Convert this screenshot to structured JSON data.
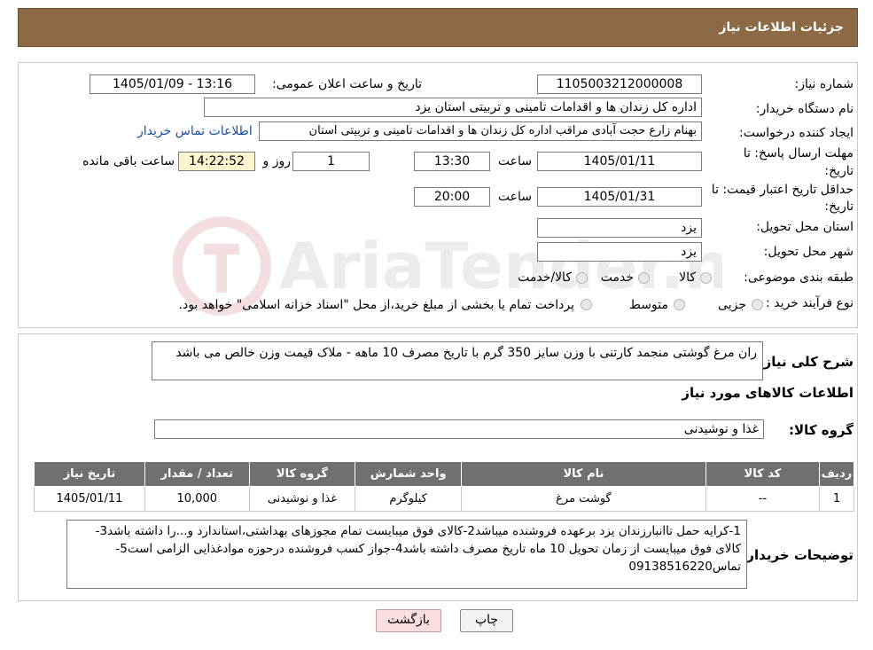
{
  "header": {
    "title": "جزئیات اطلاعات نیاز"
  },
  "form": {
    "need_number_label": "شماره نیاز:",
    "need_number": "1105003212000008",
    "announce_label": "تاریخ و ساعت اعلان عمومی:",
    "announce_value": "1405/01/09 - 13:16",
    "buyer_label": "نام دستگاه خریدار:",
    "buyer_value": "اداره کل زندان ها و اقدامات تامینی و تربیتی استان یزد",
    "creator_label": "ایجاد کننده درخواست:",
    "creator_value": "بهنام زارع حجت آبادی مراقب اداره کل زندان ها و اقدامات تامینی و تربیتی استان",
    "contact_link": "اطلاعات تماس خریدار",
    "deadline_label_1": "مهلت ارسال پاسخ: تا",
    "deadline_label_2": "تاریخ:",
    "deadline_date": "1405/01/11",
    "time_label": "ساعت",
    "deadline_time": "13:30",
    "days_value": "1",
    "days_label": "روز و",
    "remaining_value": "14:22:52",
    "remaining_label": "ساعت باقی مانده",
    "validity_label_1": "حداقل تاریخ اعتبار قیمت: تا",
    "validity_label_2": "تاریخ:",
    "validity_date": "1405/01/31",
    "validity_time": "20:00",
    "province_label": "استان محل تحویل:",
    "province_value": "یزد",
    "city_label": "شهر محل تحویل:",
    "city_value": "یزد",
    "category_label": "طبقه بندی موضوعی:",
    "category_opt_1": "کالا",
    "category_opt_2": "خدمت",
    "category_opt_3": "کالا/خدمت",
    "process_label": "نوع فرآیند خرید :",
    "process_opt_1": "جزیی",
    "process_opt_2": "متوسط",
    "process_note": "پرداخت تمام یا بخشی از مبلغ خرید،از محل \"اسناد خزانه اسلامی\" خواهد بود."
  },
  "description": {
    "label": "شرح کلی نیاز:",
    "value": "ران مرغ گوشتی منجمد کارتنی با وزن سایز 350 گرم با تاریخ مصرف 10 ماهه - ملاک قیمت وزن خالص می باشد"
  },
  "goods": {
    "section_title": "اطلاعات کالاهای مورد نیاز",
    "group_label": "گروه کالا:",
    "group_value": "غذا و نوشیدنی",
    "columns": [
      "ردیف",
      "کد کالا",
      "نام کالا",
      "واحد شمارش",
      "گروه کالا",
      "تعداد / مقدار",
      "تاریخ نیاز"
    ],
    "rows": [
      [
        "1",
        "--",
        "گوشت مرغ",
        "کیلوگرم",
        "غذا و نوشیدنی",
        "10,000",
        "1405/01/11"
      ]
    ]
  },
  "notes": {
    "label": "توضیحات خریدار:",
    "value": "1-کرایه حمل تاانبارزندان یزد برعهده فروشنده میباشد2-کالای فوق میبایست تمام مجوزهای بهداشتی،استاندارد و...را داشته باشد3-کالای فوق میبایست از زمان تحویل 10 ماه تاریخ مصرف داشته باشد4-جواز کسب فروشنده درحوزه موادغذایی الزامی است5-تماس09138516220"
  },
  "buttons": {
    "print": "چاپ",
    "back": "بازگشت"
  },
  "watermark": {
    "text": "AriaTender.neT"
  }
}
